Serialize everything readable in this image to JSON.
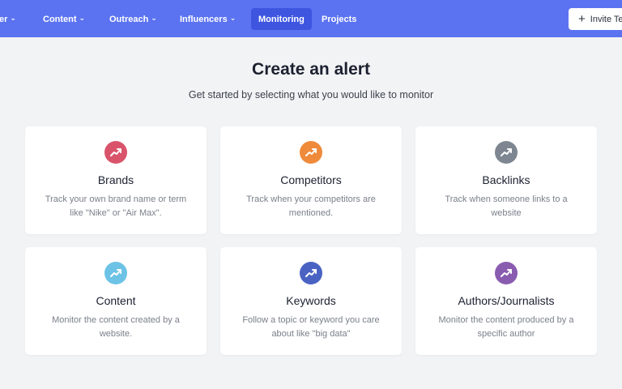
{
  "nav": {
    "items": [
      {
        "label": "er",
        "chevron": true
      },
      {
        "label": "Content",
        "chevron": true
      },
      {
        "label": "Outreach",
        "chevron": true
      },
      {
        "label": "Influencers",
        "chevron": true
      },
      {
        "label": "Monitoring",
        "chevron": false,
        "active": true
      },
      {
        "label": "Projects",
        "chevron": false
      }
    ],
    "invite_label": "Invite Te",
    "invite_icon": "plus-icon"
  },
  "main": {
    "title": "Create an alert",
    "subtitle": "Get started by selecting what you would like to monitor"
  },
  "cards": [
    {
      "title": "Brands",
      "description": "Track your own brand name or term like \"Nike\" or \"Air Max\".",
      "icon": "trending-up-icon",
      "color": "#d9546b"
    },
    {
      "title": "Competitors",
      "description": "Track when your competitors are mentioned.",
      "icon": "trending-up-icon",
      "color": "#ef8a3a"
    },
    {
      "title": "Backlinks",
      "description": "Track when someone links to a website",
      "icon": "trending-up-icon",
      "color": "#7e8791"
    },
    {
      "title": "Content",
      "description": "Monitor the content created by a website.",
      "icon": "trending-up-icon",
      "color": "#6cc3e6"
    },
    {
      "title": "Keywords",
      "description": "Follow a topic or keyword you care about like \"big data\"",
      "icon": "trending-up-icon",
      "color": "#4a63c2"
    },
    {
      "title": "Authors/Journalists",
      "description": "Monitor the content produced by a specific author",
      "icon": "trending-up-icon",
      "color": "#8a5cb0"
    }
  ],
  "colors": {
    "topbar": "#5b73f0",
    "active_tab": "#3e55e0",
    "background": "#f2f3f5"
  }
}
